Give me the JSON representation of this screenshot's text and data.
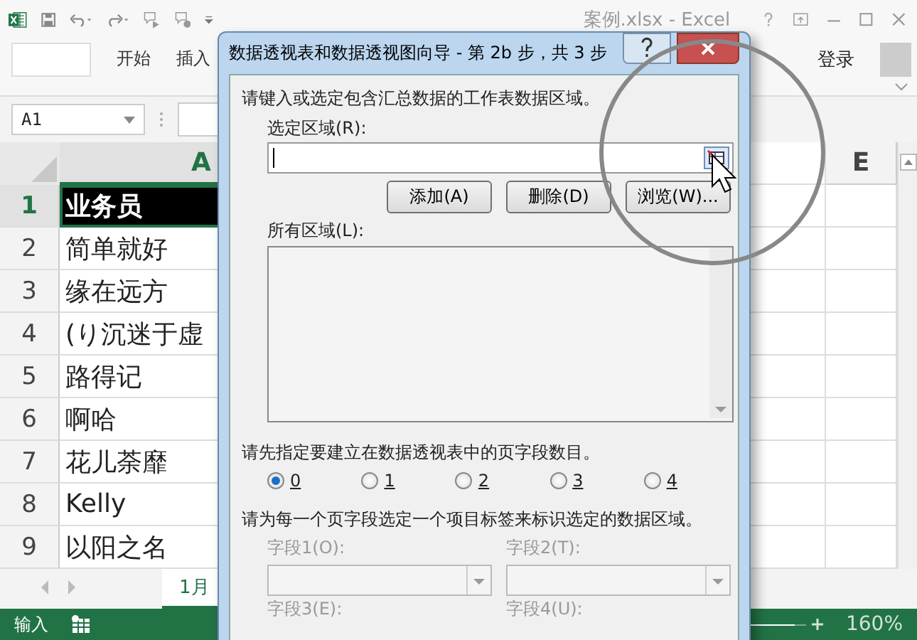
{
  "excel": {
    "title": "案例.xlsx - Excel",
    "ribbon_tabs": [
      "开始",
      "插入"
    ],
    "sign_in": "登录",
    "name_box": "A1",
    "columns": [
      {
        "label": "A",
        "selected": true
      },
      {
        "label": "E",
        "selected": false
      }
    ],
    "rows": [
      {
        "number": "1",
        "value": "业务员",
        "selected": true
      },
      {
        "number": "2",
        "value": "简单就好",
        "selected": false
      },
      {
        "number": "3",
        "value": "缘在远方",
        "selected": false
      },
      {
        "number": "4",
        "value": "(り沉迷于虚",
        "selected": false
      },
      {
        "number": "5",
        "value": "路得记",
        "selected": false
      },
      {
        "number": "6",
        "value": "啊哈",
        "selected": false
      },
      {
        "number": "7",
        "value": "花儿荼靡",
        "selected": false
      },
      {
        "number": "8",
        "value": "Kelly",
        "selected": false
      },
      {
        "number": "9",
        "value": "以阳之名",
        "selected": false
      }
    ],
    "sheet_tabs": [
      {
        "label": "1月",
        "selected": true
      }
    ],
    "status": "输入",
    "zoom": "160%",
    "zoom_slider": {
      "level": 0.8
    }
  },
  "dialog": {
    "title": "数据透视表和数据透视图向导 - 第 2b 步，共 3 步",
    "prompt": "请键入或选定包含汇总数据的工作表数据区域。",
    "range_label": "选定区域(R):",
    "buttons": [
      "添加(A)",
      "删除(D)",
      "浏览(W)..."
    ],
    "all_ranges_label": "所有区域(L):",
    "page_fields_prompt": "请先指定要建立在数据透视表中的页字段数目。",
    "page_field_counts": [
      {
        "label": "0",
        "selected": true
      },
      {
        "label": "1",
        "selected": false
      },
      {
        "label": "2",
        "selected": false
      },
      {
        "label": "3",
        "selected": false
      },
      {
        "label": "4",
        "selected": false
      }
    ],
    "fields_prompt": "请为每一个页字段选定一个项目标签来标识选定的数据区域。",
    "fields": [
      {
        "label": "字段1(O):",
        "disabled": true,
        "dropdown": true
      },
      {
        "label": "字段2(T):",
        "disabled": true,
        "dropdown": true
      },
      {
        "label": "字段3(E):",
        "disabled": true,
        "dropdown": false
      },
      {
        "label": "字段4(U):",
        "disabled": true,
        "dropdown": false
      }
    ]
  }
}
